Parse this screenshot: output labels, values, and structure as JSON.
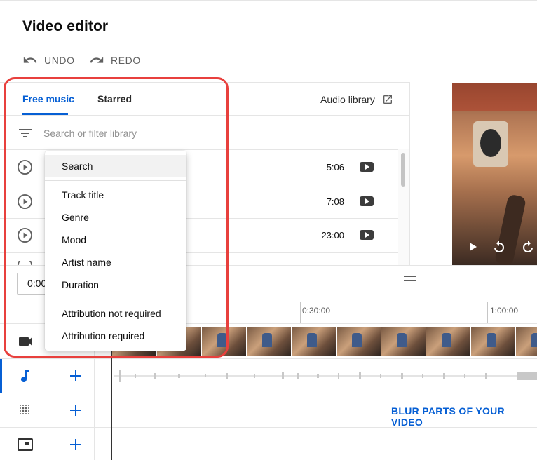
{
  "page": {
    "title": "Video editor"
  },
  "toolbar": {
    "undo_label": "UNDO",
    "redo_label": "REDO"
  },
  "library": {
    "tabs": [
      {
        "label": "Free music"
      },
      {
        "label": "Starred"
      }
    ],
    "audio_library_link": "Audio library",
    "search": {
      "placeholder": "Search or filter library"
    },
    "tracks": [
      {
        "duration": "5:06"
      },
      {
        "duration": "7:08"
      },
      {
        "duration": "23:00"
      }
    ]
  },
  "filter_menu": {
    "items": [
      {
        "label": "Search"
      },
      {
        "label": "Track title"
      },
      {
        "label": "Genre"
      },
      {
        "label": "Mood"
      },
      {
        "label": "Artist name"
      },
      {
        "label": "Duration"
      },
      {
        "label": "Attribution not required"
      },
      {
        "label": "Attribution required"
      }
    ]
  },
  "timeline": {
    "current_time": "0:00",
    "ruler_labels": [
      "0:30:00",
      "1:00:00"
    ],
    "blur_link": "BLUR PARTS OF YOUR VIDEO"
  },
  "icons": {
    "undo": "undo-icon",
    "redo": "redo-icon",
    "filter": "filter-icon",
    "open_external": "open-in-new-icon",
    "play": "play-circle-icon",
    "youtube": "youtube-icon",
    "video_track": "video-camera-icon",
    "music_track": "music-note-icon",
    "blur_track": "blur-icon",
    "endscreen_track": "end-screen-icon",
    "add": "add-icon"
  },
  "colors": {
    "accent": "#065fd4",
    "annotation": "#e8403d"
  }
}
